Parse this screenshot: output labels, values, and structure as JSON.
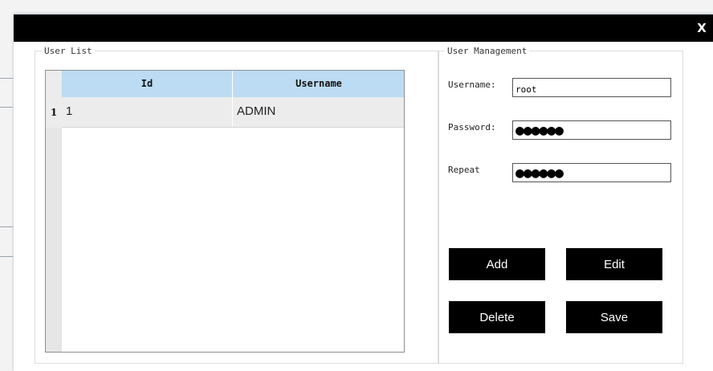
{
  "window": {
    "close_glyph": "X"
  },
  "user_list": {
    "legend": "User List",
    "columns": [
      "Id",
      "Username"
    ],
    "rows": [
      {
        "num": "1",
        "id": "1",
        "username": "ADMIN"
      }
    ]
  },
  "user_management": {
    "legend": "User Management",
    "username_label": "Username:",
    "username_value": "root",
    "password_label": "Password:",
    "password_value": "●●●●●●",
    "repeat_label": "Repeat",
    "repeat_value": "●●●●●●"
  },
  "buttons": {
    "add": "Add",
    "edit": "Edit",
    "delete": "Delete",
    "save": "Save"
  },
  "colors": {
    "titlebar": "#000000",
    "grid_header": "#bcdcf3",
    "button_bg": "#000000"
  }
}
